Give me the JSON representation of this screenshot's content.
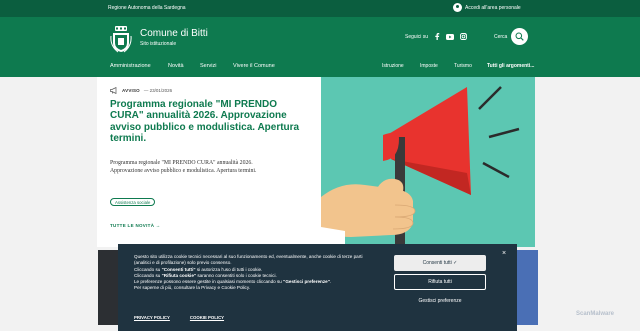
{
  "topbar": {
    "region": "Regione Autonoma della Sardegna",
    "login": "Accedi all'area personale"
  },
  "header": {
    "title": "Comune di Bitti",
    "subtitle": "Sito istituzionale",
    "follow_label": "Seguici su",
    "search_label": "Cerca"
  },
  "nav": {
    "main": [
      "Amministrazione",
      "Novità",
      "Servizi",
      "Vivere il Comune"
    ],
    "secondary": [
      "Istruzione",
      "Imposte",
      "Turismo",
      "Tutti gli argomenti..."
    ]
  },
  "news": {
    "category": "AVVISO",
    "date": "— 23/01/2026",
    "title": "Programma regionale \"MI PRENDO CURA\" annualità 2026. Approvazione avviso pubblico e modulistica. Apertura termini.",
    "description": "Programma regionale \"MI PRENDO CURA\" annualità 2026. Approvazione avviso pubblico e modulistica. Apertura termini.",
    "tag": "Assistenza sociale",
    "all_news": "TUTTE LE NOVITÀ →"
  },
  "cookie": {
    "line1": "Questo sito utilizza cookie tecnici necessari al suo funzionamento ed, eventualmente, anche cookie di terze parti (analitici e di profilazione) solo previo consenso.",
    "line2a": "Cliccando su ",
    "line2b": "\"Consenti tutti\"",
    "line2c": " si autorizza l'uso di tutti i cookie.",
    "line3a": "Cliccando su ",
    "line3b": "\"Rifiuta cookie\"",
    "line3c": " saranno consentiti solo i cookie tecnici.",
    "line4a": "Le preferenze possono essere gestite in qualsiasi momento cliccando su ",
    "line4b": "\"Gestisci preferenze\"",
    "line4c": ".",
    "line5": "Per saperne di più, consultare la Privacy e Cookie Policy.",
    "accept": "Consenti tutti ✓",
    "reject": "Rifiuta tutti",
    "manage": "Gestisci preferenze",
    "privacy_link": "PRIVACY POLICY",
    "cookie_link": "COOKIE POLICY",
    "close": "×"
  },
  "watermark": "ScanMalware",
  "colors": {
    "brand_dark": "#0b5e3f",
    "brand": "#0e7a4f",
    "hero_bg": "#5cc7b2",
    "megaphone": "#e8332e",
    "cookie_bg": "#1f3340"
  }
}
